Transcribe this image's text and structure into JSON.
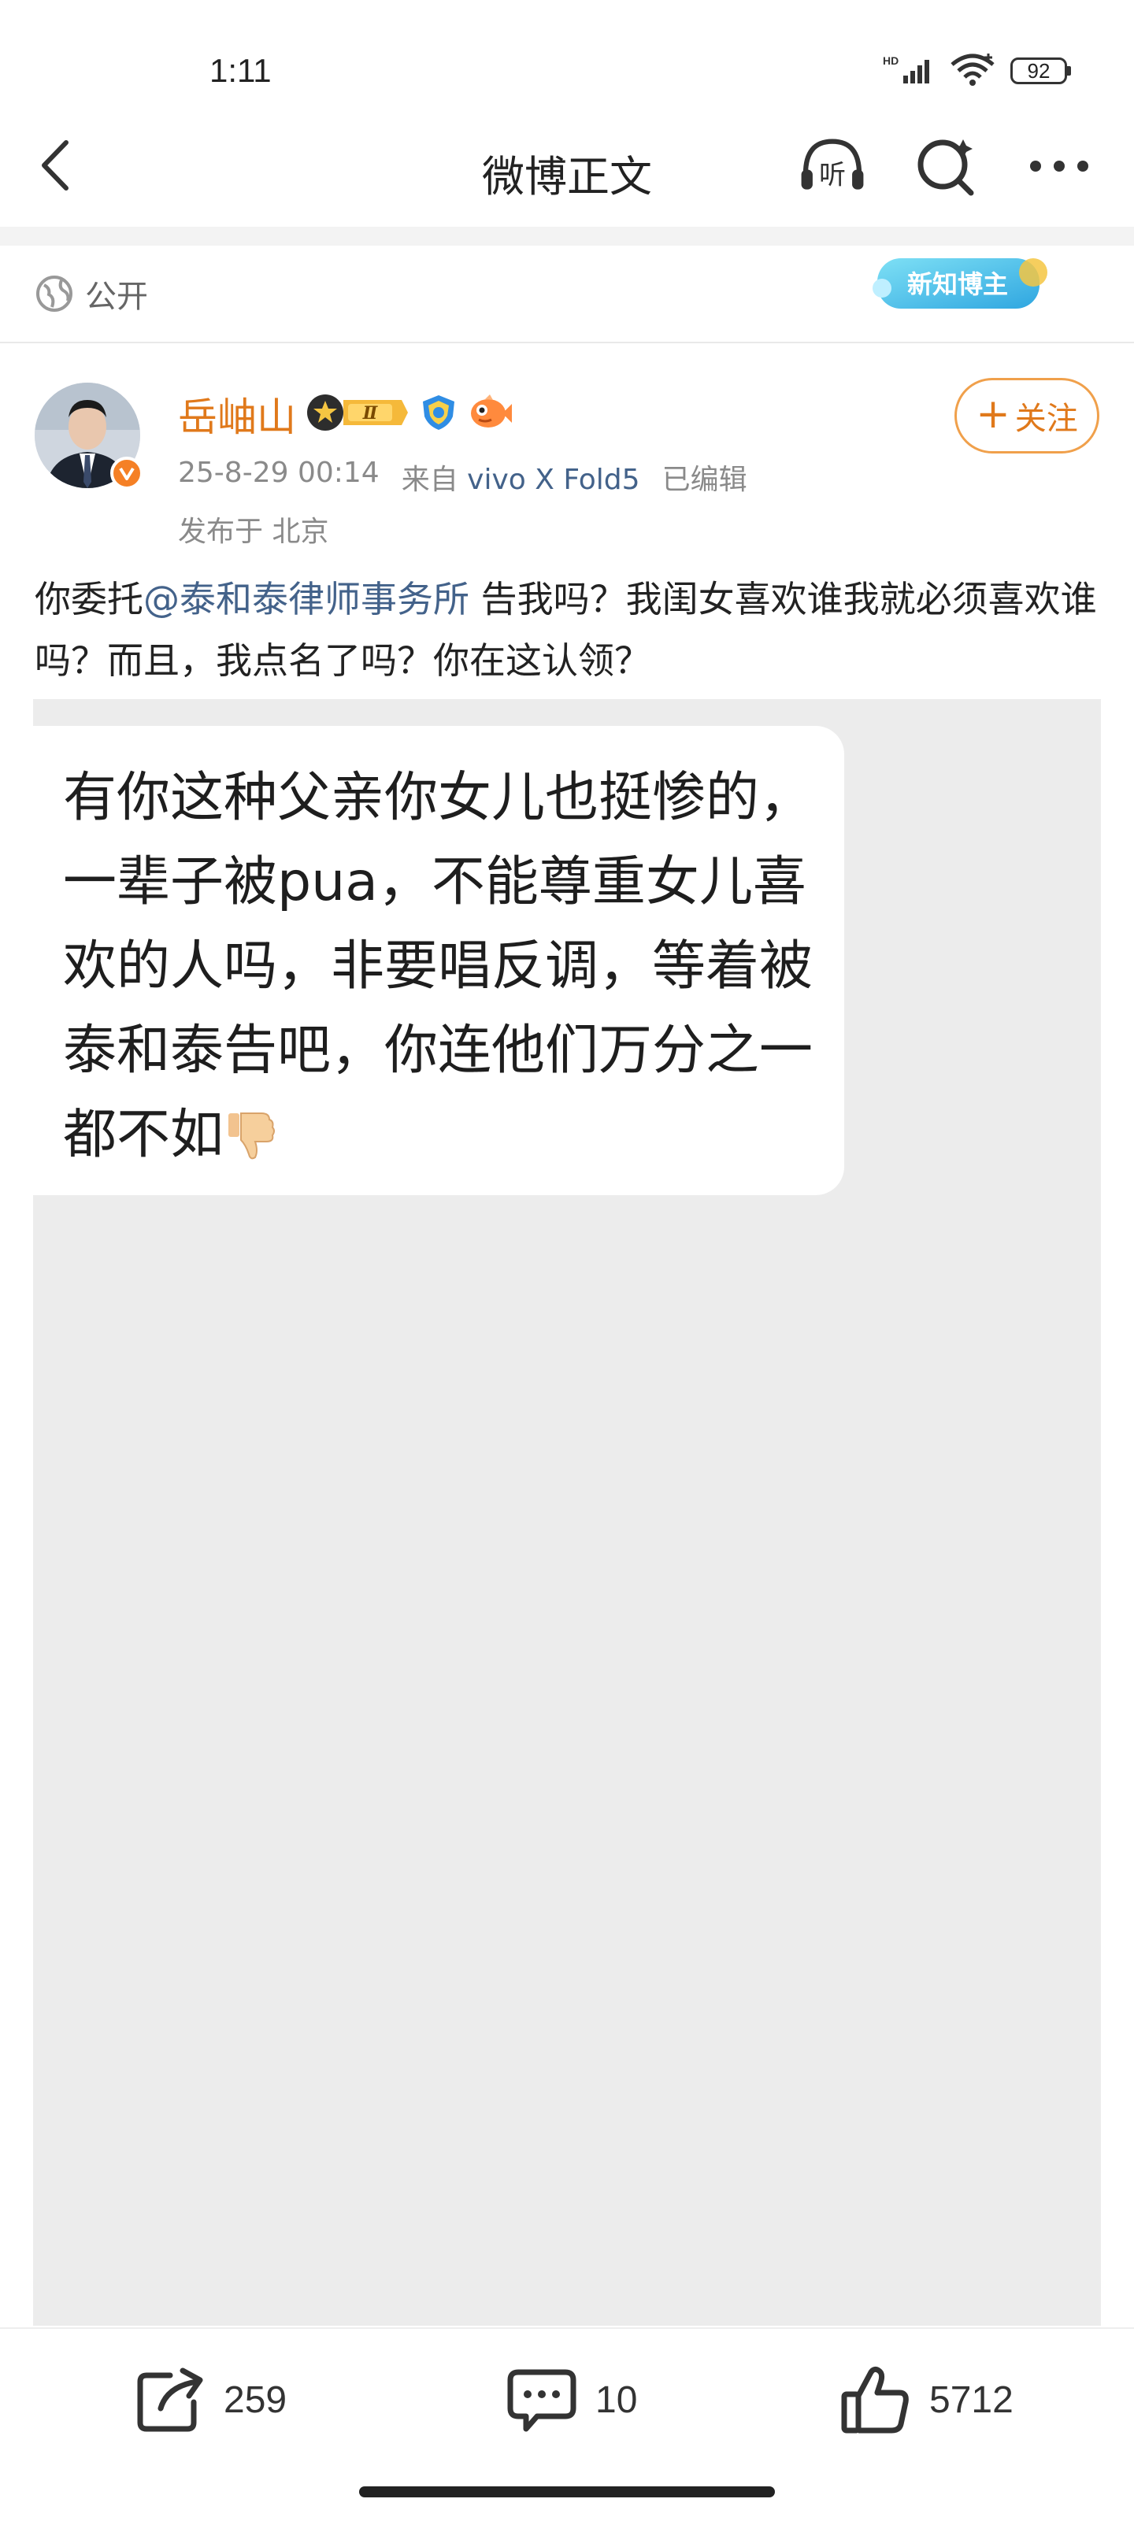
{
  "status_bar": {
    "time": "1:11",
    "network_label": "HD",
    "battery": "92"
  },
  "nav": {
    "title": "微博正文",
    "listen_icon_text": "听",
    "icons": [
      "back-arrow-icon",
      "listen-icon",
      "search-icon",
      "more-icon"
    ]
  },
  "visibility": {
    "label": "公开",
    "badge_text": "新知博主"
  },
  "author": {
    "name": "岳岫山",
    "level_badge": "Ⅱ",
    "follow_label": "关注",
    "date": "25-8-29 00:14",
    "source_prefix": "来自",
    "device": "vivo X Fold5",
    "edited": "已编辑",
    "location": "发布于 北京"
  },
  "post": {
    "text_before_mention": "你委托",
    "mention": "@泰和泰律师事务所",
    "text_after_mention": " 告我吗？我闺女喜欢谁我就必须喜欢谁吗？而且，我点名了吗？你在这认领？"
  },
  "image": {
    "bubble_text": "有你这种父亲你女儿也挺惨的，一辈子被pua，不能尊重女儿喜欢的人吗，非要唱反调，等着被泰和泰告吧，你连他们万分之一都不如"
  },
  "actions": {
    "repost_count": "259",
    "comment_count": "10",
    "like_count": "5712"
  },
  "colors": {
    "accent_orange": "#e0791b",
    "link_blue": "#43628a",
    "image_bg": "#ececec"
  }
}
